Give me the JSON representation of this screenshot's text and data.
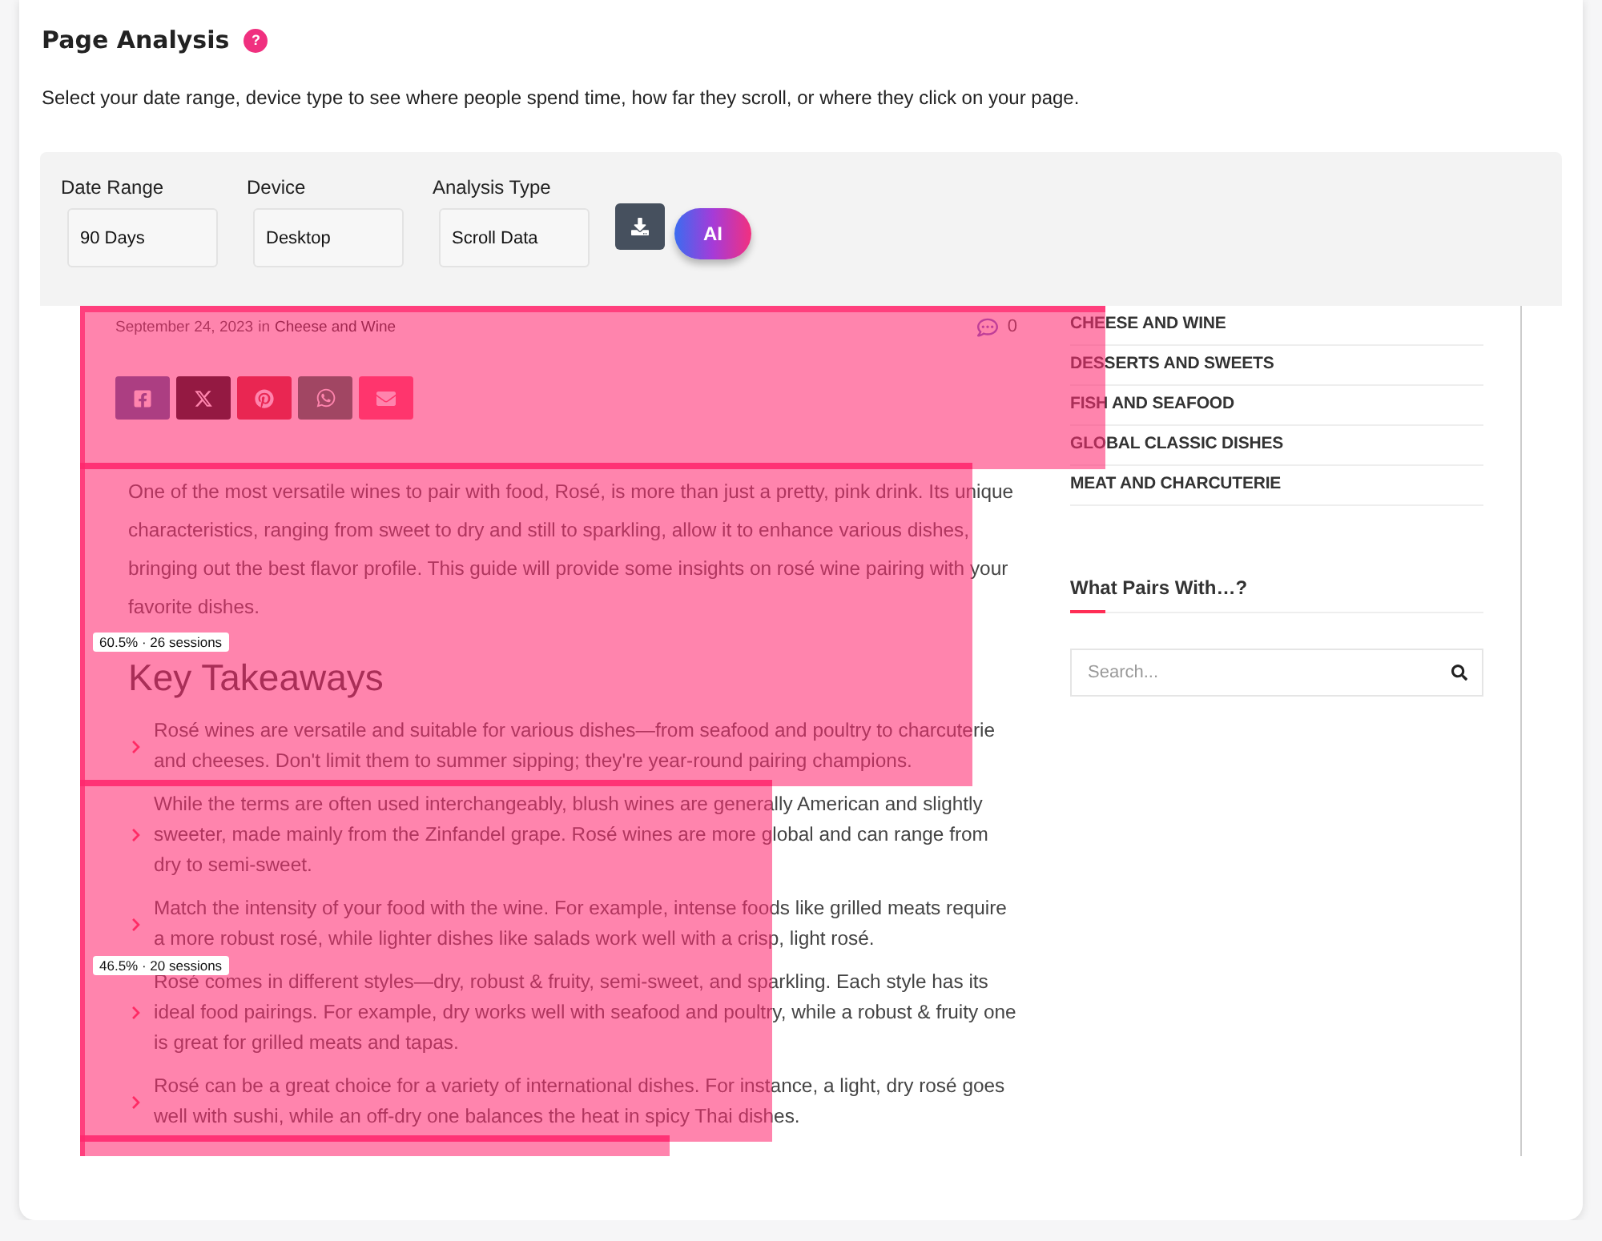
{
  "header": {
    "title": "Page Analysis",
    "help": "?",
    "description": "Select your date range, device type to see where people spend time, how far they scroll, or where they click on your page."
  },
  "filters": [
    {
      "label": "Date Range",
      "value": "90 Days"
    },
    {
      "label": "Device",
      "value": "Desktop"
    },
    {
      "label": "Analysis Type",
      "value": "Scroll Data"
    }
  ],
  "ai_button": "AI",
  "preview": {
    "meta": {
      "date": "September 24, 2023",
      "separator": "in",
      "category": "Cheese and Wine",
      "comments": "0"
    },
    "share_buttons": [
      {
        "kind": "facebook"
      },
      {
        "kind": "x"
      },
      {
        "kind": "pinterest"
      },
      {
        "kind": "whatsapp"
      },
      {
        "kind": "email"
      }
    ],
    "intro": "One of the most versatile wines to pair with food, Rosé, is more than just a pretty, pink drink. Its unique characteristics, ranging from sweet to dry and still to sparkling, allow it to enhance various dishes, bringing out the best flavor profile. This guide will provide some insights on rosé wine pairing with your favorite dishes.",
    "heading": "Key Takeaways",
    "takeaways": [
      "Rosé wines are versatile and suitable for various dishes—from seafood and poultry to charcuterie and cheeses. Don't limit them to summer sipping; they're year-round pairing champions.",
      "While the terms are often used interchangeably, blush wines are generally American and slightly sweeter, made mainly from the Zinfandel grape. Rosé wines are more global and can range from dry to semi-sweet.",
      "Match the intensity of your food with the wine. For example, intense foods like grilled meats require a more robust rosé, while lighter dishes like salads work well with a crisp, light rosé.",
      "Rosé comes in different styles—dry, robust & fruity, semi-sweet, and sparkling. Each style has its ideal food pairings. For example, dry works well with seafood and poultry, while a robust & fruity one is great for grilled meats and tapas.",
      "Rosé can be a great choice for a variety of international dishes. For instance, a light, dry rosé goes well with sushi, while an off-dry one balances the heat in spicy Thai dishes."
    ],
    "sidebar": {
      "categories": [
        "CHEESE AND WINE",
        "DESSERTS AND SWEETS",
        "FISH AND SEAFOOD",
        "GLOBAL CLASSIC DISHES",
        "MEAT AND CHARCUTERIE"
      ],
      "widget_title": "What Pairs With…?",
      "search": {
        "placeholder": "Search..."
      }
    }
  },
  "scroll_markers": [
    {
      "label": "60.5% · 26 sessions"
    },
    {
      "label": "46.5% · 20 sessions"
    }
  ]
}
